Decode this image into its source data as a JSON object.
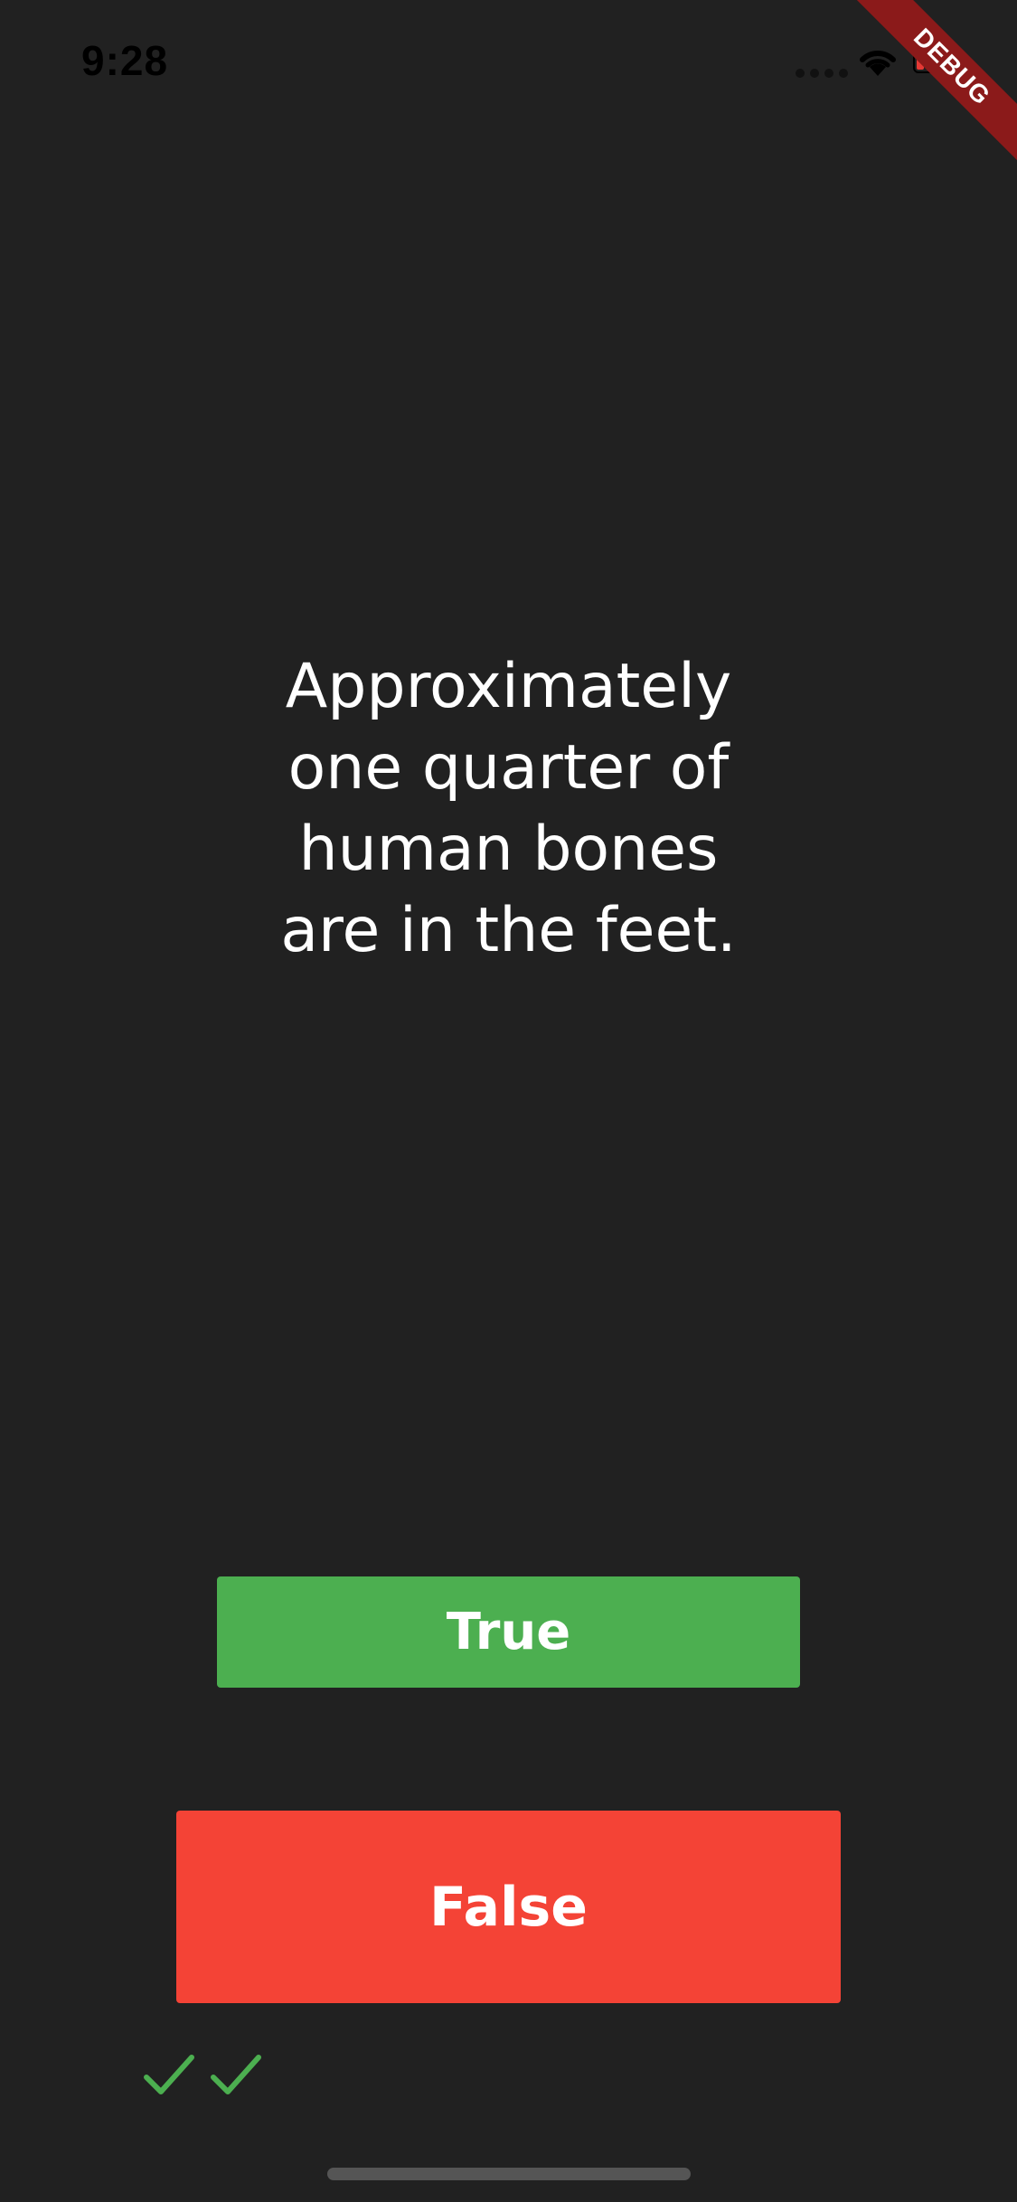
{
  "status_bar": {
    "time": "9:28"
  },
  "debug_banner": {
    "label": "DEBUG"
  },
  "quiz": {
    "question_lines": [
      "Approximately",
      "one quarter of",
      "human bones",
      "are in the feet."
    ],
    "true_label": "True",
    "false_label": "False",
    "score_icons": [
      "check-icon",
      "check-icon"
    ]
  },
  "colors": {
    "background": "#212121",
    "true_button": "#4caf50",
    "false_button": "#f44336",
    "check": "#4caf50",
    "debug_ribbon": "#8b1a1a"
  }
}
